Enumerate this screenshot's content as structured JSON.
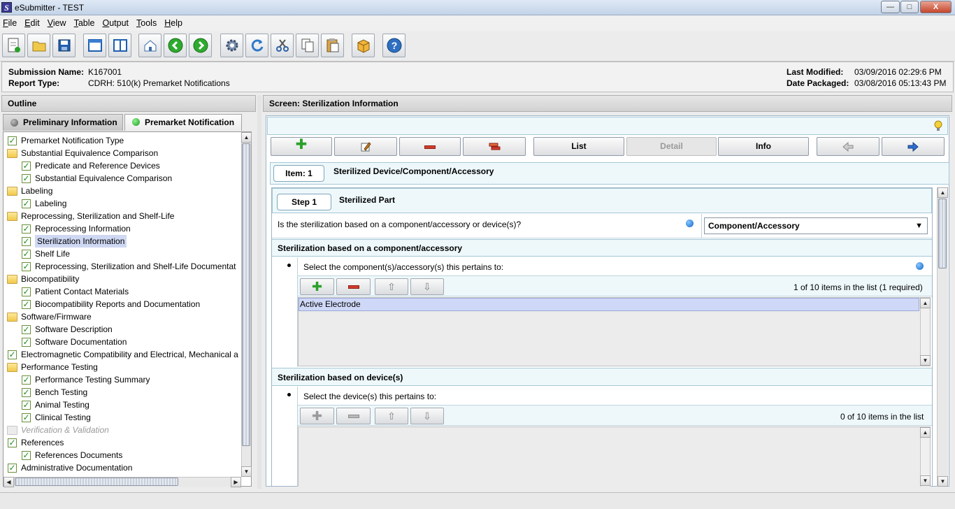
{
  "window": {
    "title": "eSubmitter - TEST",
    "minimize": "—",
    "maximize": "□",
    "close": "X"
  },
  "menu": [
    "File",
    "Edit",
    "View",
    "Table",
    "Output",
    "Tools",
    "Help"
  ],
  "toolbar": [
    "new-document",
    "open-folder",
    "save",
    "window",
    "split-view",
    "home",
    "back",
    "forward",
    "settings",
    "refresh",
    "cut",
    "copy",
    "paste",
    "package",
    "help"
  ],
  "info": {
    "submission_name_label": "Submission Name:",
    "submission_name": "K167001",
    "report_type_label": "Report Type:",
    "report_type": "CDRH: 510(k) Premarket Notifications",
    "last_modified_label": "Last Modified:",
    "last_modified": "03/09/2016 02:29:6 PM",
    "date_packaged_label": "Date Packaged:",
    "date_packaged": "03/08/2016 05:13:43 PM"
  },
  "outline": {
    "title": "Outline",
    "tabs": [
      {
        "label": "Preliminary Information",
        "status": "gray"
      },
      {
        "label": "Premarket Notification",
        "status": "green"
      }
    ],
    "items": [
      {
        "label": "Premarket Notification Type",
        "icon": "check",
        "level": 0
      },
      {
        "label": "Substantial Equivalence Comparison",
        "icon": "folder",
        "level": 0
      },
      {
        "label": "Predicate and Reference Devices",
        "icon": "check",
        "level": 1
      },
      {
        "label": "Substantial Equivalence Comparison",
        "icon": "check",
        "level": 1
      },
      {
        "label": "Labeling",
        "icon": "folder",
        "level": 0
      },
      {
        "label": "Labeling",
        "icon": "check",
        "level": 1
      },
      {
        "label": "Reprocessing, Sterilization and Shelf-Life",
        "icon": "folder",
        "level": 0
      },
      {
        "label": "Reprocessing Information",
        "icon": "check",
        "level": 1
      },
      {
        "label": "Sterilization Information",
        "icon": "check",
        "level": 1,
        "selected": true
      },
      {
        "label": "Shelf Life",
        "icon": "check",
        "level": 1
      },
      {
        "label": "Reprocessing, Sterilization and Shelf-Life Documentat",
        "icon": "check",
        "level": 1
      },
      {
        "label": "Biocompatibility",
        "icon": "folder",
        "level": 0
      },
      {
        "label": "Patient Contact Materials",
        "icon": "check",
        "level": 1
      },
      {
        "label": "Biocompatibility Reports and Documentation",
        "icon": "check",
        "level": 1
      },
      {
        "label": "Software/Firmware",
        "icon": "folder",
        "level": 0
      },
      {
        "label": "Software Description",
        "icon": "check",
        "level": 1
      },
      {
        "label": "Software Documentation",
        "icon": "check",
        "level": 1
      },
      {
        "label": "Electromagnetic Compatibility and Electrical, Mechanical a",
        "icon": "check",
        "level": 0
      },
      {
        "label": "Performance Testing",
        "icon": "folder",
        "level": 0
      },
      {
        "label": "Performance Testing Summary",
        "icon": "check",
        "level": 1
      },
      {
        "label": "Bench Testing",
        "icon": "check",
        "level": 1
      },
      {
        "label": "Animal Testing",
        "icon": "check",
        "level": 1
      },
      {
        "label": "Clinical Testing",
        "icon": "check",
        "level": 1
      },
      {
        "label": "Verification & Validation",
        "icon": "folder-disabled",
        "level": 0,
        "disabled": true
      },
      {
        "label": "References",
        "icon": "check",
        "level": 0
      },
      {
        "label": "References Documents",
        "icon": "check",
        "level": 1
      },
      {
        "label": "Administrative Documentation",
        "icon": "check",
        "level": 0
      }
    ]
  },
  "screen": {
    "title": "Screen: Sterilization Information",
    "buttons": {
      "list": "List",
      "detail": "Detail",
      "info": "Info"
    },
    "item_tag": "Item: 1",
    "item_title": "Sterilized Device/Component/Accessory",
    "step_tag": "Step 1",
    "step_title": "Sterilized Part",
    "question": "Is the sterilization based on a component/accessory or device(s)?",
    "question_value": "Component/Accessory",
    "section1": {
      "title": "Sterilization based on a component/accessory",
      "prompt": "Select the component(s)/accessory(s) this pertains to:",
      "count": "1 of 10 items in the list (1 required)",
      "items": [
        "Active Electrode"
      ]
    },
    "section2": {
      "title": "Sterilization based on device(s)",
      "prompt": "Select the device(s) this pertains to:",
      "count": "0 of 10 items in the list"
    }
  }
}
